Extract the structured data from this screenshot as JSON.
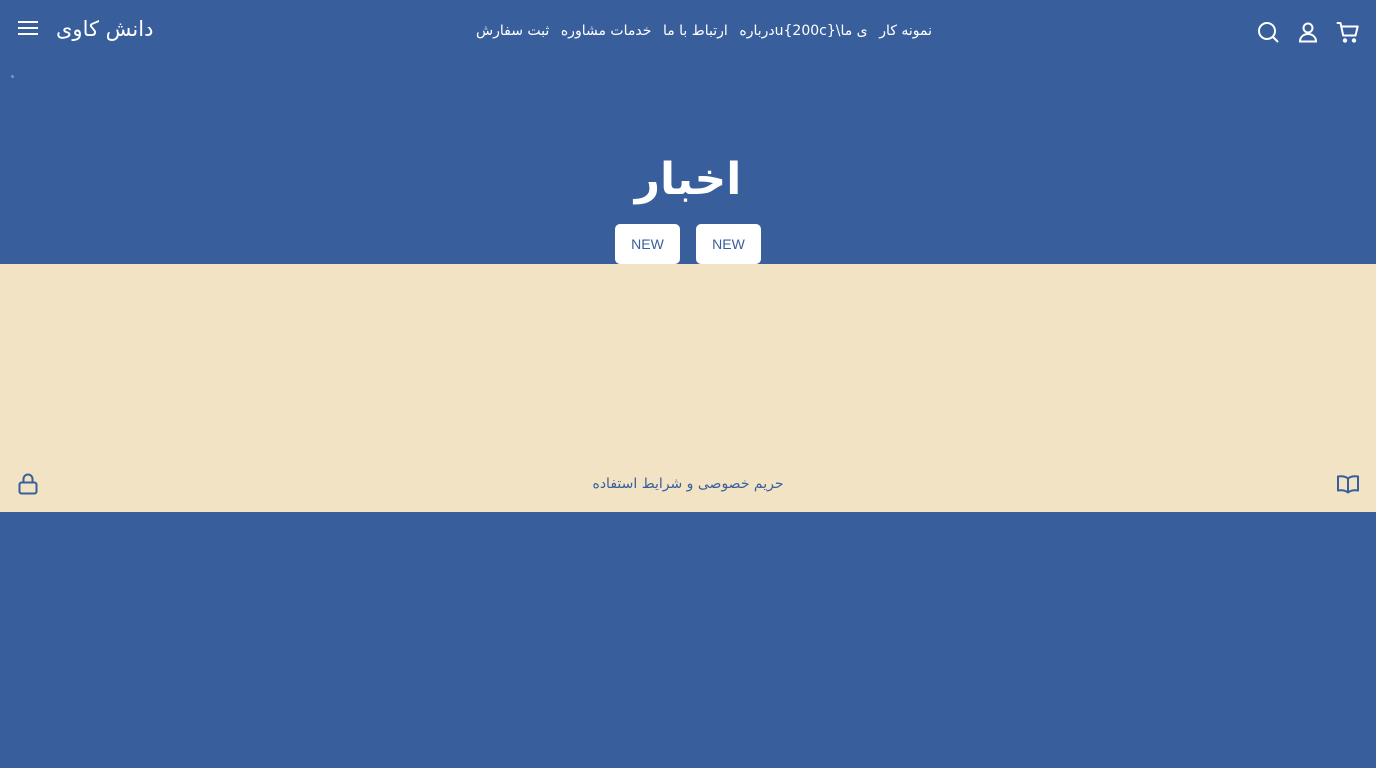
{
  "header": {
    "logo_text": "دانش کاوی",
    "nav": [
      {
        "label": "ثبت سفارش"
      },
      {
        "label": "خدمات مشاوره"
      },
      {
        "label": "ارتباط با ما"
      },
      {
        "label": "ی ما\\u{200c}درباره"
      },
      {
        "label": "نمونه کار"
      }
    ],
    "icons": [
      "menu-icon",
      "search-icon",
      "account-icon",
      "cart-icon"
    ]
  },
  "hero": {
    "title": "اخبار",
    "tags": [
      {
        "label": "NEW"
      },
      {
        "label": "NEW"
      }
    ]
  },
  "footer": {
    "policy_text": "حریم خصوصی و شرایط استفاده",
    "icons": [
      "lock-icon",
      "book-icon"
    ]
  },
  "colors": {
    "primary": "#385f9c",
    "surface": "#f2e3c4",
    "text_light": "#ffffff"
  }
}
